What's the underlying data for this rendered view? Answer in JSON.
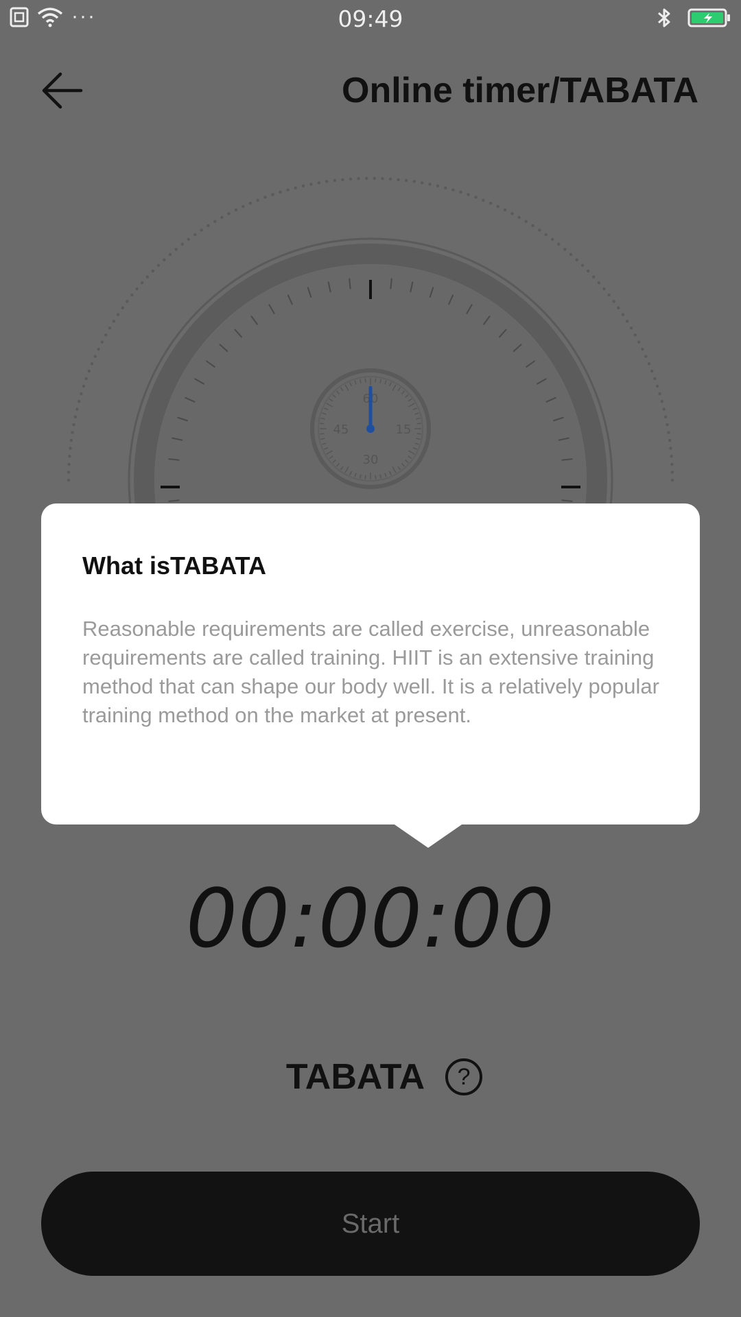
{
  "status_bar": {
    "time": "09:49",
    "more_dots": "···",
    "icons": [
      "sim-icon",
      "wifi-icon",
      "bluetooth-icon",
      "battery-charging-icon"
    ]
  },
  "header": {
    "title": "Online timer/TABATA",
    "back_icon": "back-arrow-icon"
  },
  "dial": {
    "sub_dial_labels": [
      "60",
      "15",
      "30",
      "45"
    ]
  },
  "popup": {
    "title": "What isTABATA",
    "body": "Reasonable requirements are called exercise, unreasonable requirements are called training. HIIT is an extensive training method that can shape our body well. It is a relatively popular training method on the market at present."
  },
  "timer": {
    "display": "00:00:00"
  },
  "mode": {
    "label": "TABATA",
    "help_glyph": "?"
  },
  "actions": {
    "start_label": "Start"
  },
  "colors": {
    "overlay_background": "#6b6b6b",
    "popup_background": "#ffffff",
    "button_background": "#121212",
    "battery_accent": "#2ecc71",
    "hand_accent": "#1f4f9e"
  }
}
